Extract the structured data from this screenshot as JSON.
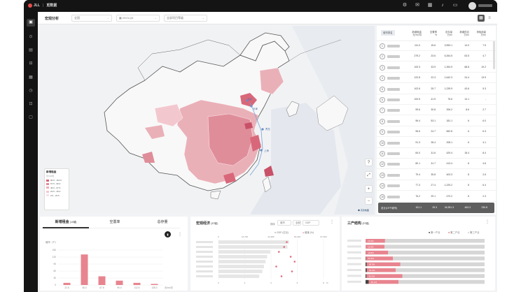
{
  "topbar": {
    "logo_left": "JLL",
    "logo_right": "觅数据",
    "icons": [
      "settings-icon",
      "mail-icon",
      "calendar-icon",
      "bell-icon",
      "chat-icon"
    ]
  },
  "sidebar": {
    "items": [
      {
        "name": "sidebar-item-macro",
        "icon": "▣"
      },
      {
        "name": "sidebar-item-2",
        "icon": "⊙"
      },
      {
        "name": "sidebar-item-3",
        "icon": "▤"
      },
      {
        "name": "sidebar-item-4",
        "icon": "⊟"
      },
      {
        "name": "sidebar-item-5",
        "icon": "▦"
      },
      {
        "name": "sidebar-item-6",
        "icon": "◷"
      },
      {
        "name": "sidebar-item-7",
        "icon": "⊡"
      },
      {
        "name": "sidebar-item-8",
        "icon": "▢"
      }
    ]
  },
  "filters": {
    "title": "宏观分析",
    "region": "全国",
    "period": "2023-Q4",
    "property": "全部项目等级"
  },
  "map": {
    "labels": [
      "北京",
      "天津",
      "青岛",
      "上海"
    ],
    "legend": {
      "title": "新增租金",
      "unit": "元/m²/月",
      "items": [
        {
          "label": "90.0 - 110.0",
          "color": "#d9677a"
        },
        {
          "label": "67.5 - 90.0",
          "color": "#e58a97"
        },
        {
          "label": "45.0 - 67.5",
          "color": "#eeadb6"
        },
        {
          "label": "22.5 - 45.0",
          "color": "#f4c9cf"
        },
        {
          "label": "0.0 - 22.5",
          "color": "#f9e1e4"
        }
      ]
    },
    "note": "◆ 高德地图"
  },
  "table": {
    "headers": [
      "城市排名",
      "新增租金",
      "空置率",
      "总存量",
      "新增供应",
      "净吸纳量"
    ],
    "units": [
      "元/m²/月",
      "%",
      "万m²",
      "万m²",
      "万m²"
    ],
    "rows": [
      [
        "1",
        "111.0",
        "15.6",
        "3,953.1",
        "14.0",
        "7.5"
      ],
      [
        "2",
        "279.2",
        "23.6",
        "6,264.5",
        "63.5",
        "4.7"
      ],
      [
        "3",
        "100.3",
        "33.9",
        "1,394.9",
        "68.8",
        "19.2"
      ],
      [
        "4",
        "122.8",
        "22.3",
        "1,642.3",
        "24.4",
        "13.9"
      ],
      [
        "5",
        "102.6",
        "25.7",
        "1,239.9",
        "43.6",
        "9.3"
      ],
      [
        "6",
        "100.5",
        "41.9",
        "75.6",
        "14.1",
        "-"
      ],
      [
        "7",
        "99.6",
        "30.8",
        "206.2",
        "8.6",
        "2.7"
      ],
      [
        "8",
        "96.4",
        "53.1",
        "181.1",
        "6",
        "6.0"
      ],
      [
        "9",
        "96.6",
        "24.7",
        "662.8",
        "6",
        "6.3"
      ],
      [
        "10",
        "91.3",
        "28.4",
        "208.1",
        "6",
        "4.1"
      ],
      [
        "11",
        "84.0",
        "31.6",
        "429.4",
        "18.4",
        "8.4"
      ],
      [
        "12",
        "80.1",
        "31.7",
        "413.4",
        "8",
        "4.6"
      ],
      [
        "13",
        "79.4",
        "35.8",
        "403.3",
        "8",
        "2.6"
      ],
      [
        "14",
        "77.3",
        "27.4",
        "1,229.2",
        "8",
        "6.4"
      ],
      [
        "15",
        "76.2",
        "29.1",
        "470.2",
        "8",
        "2.3"
      ]
    ],
    "footer": [
      "总计(19个城市)",
      "101.1",
      "25.3",
      "34,951.3",
      "463.3",
      "230.8"
    ]
  },
  "panel1": {
    "tabs": [
      "新增租金",
      "空置率",
      "总存量"
    ],
    "unit_tag": "(10城)",
    "y_title": "城市（个）",
    "x_unit": "元/m²/月",
    "toggle": "▮",
    "chart_data": {
      "type": "bar",
      "categories": [
        "22.5",
        "45.0",
        "67.5",
        "90.0",
        "112.5",
        "135.0"
      ],
      "values": [
        1,
        14,
        4,
        2,
        1,
        0.5
      ],
      "y_ticks": [
        "0",
        "30",
        "60",
        "90",
        "120",
        "150"
      ],
      "ylim": [
        0,
        16
      ]
    }
  },
  "panel2": {
    "title": "宏观经济",
    "unit_tag": "(57城)",
    "controls": [
      "排序",
      "城市",
      "全部",
      "GDP"
    ],
    "legend": [
      "GDP (亿元)",
      "增速 (%)"
    ],
    "top_ticks": [
      "0",
      "16,740",
      "33,480",
      "50,220",
      "67,000"
    ],
    "bottom_ticks": [
      "0",
      "2",
      "4",
      "6",
      "8"
    ],
    "chart_data": {
      "type": "bar",
      "series": [
        {
          "name": "GDP (亿元)",
          "values": [
            45000,
            44000,
            33000,
            31000,
            30000,
            29000,
            28000,
            26000
          ]
        },
        {
          "name": "增速 (%)",
          "values": [
            5.2,
            5.0,
            4.6,
            5.5,
            5.8,
            4.4,
            5.6,
            4.8
          ]
        }
      ]
    }
  },
  "panel3": {
    "title": "三产结构",
    "unit_tag": "(57城)",
    "legend": [
      "第一产业",
      "第二产业",
      "第三产业"
    ],
    "chart_data": {
      "type": "bar",
      "series": [
        {
          "name": "第一产业",
          "values": [
            0.1,
            0.1,
            0.2,
            0.3,
            1.0,
            1.1,
            0.8,
            2.7
          ]
        },
        {
          "name": "第二产业",
          "values": [
            16.3,
            15.9,
            18.8,
            22.8,
            28.3,
            24.2,
            30.1,
            25.1
          ]
        },
        {
          "name": "第三产业",
          "values": [
            83.6,
            84.0,
            81.0,
            76.9,
            70.7,
            74.7,
            69.1,
            72.2
          ]
        }
      ],
      "labels": [
        "16.3%",
        "15.9%",
        "18.8%",
        "22.8%",
        "28.3%",
        "24.2%",
        "30.1%",
        "25.1%"
      ]
    }
  }
}
